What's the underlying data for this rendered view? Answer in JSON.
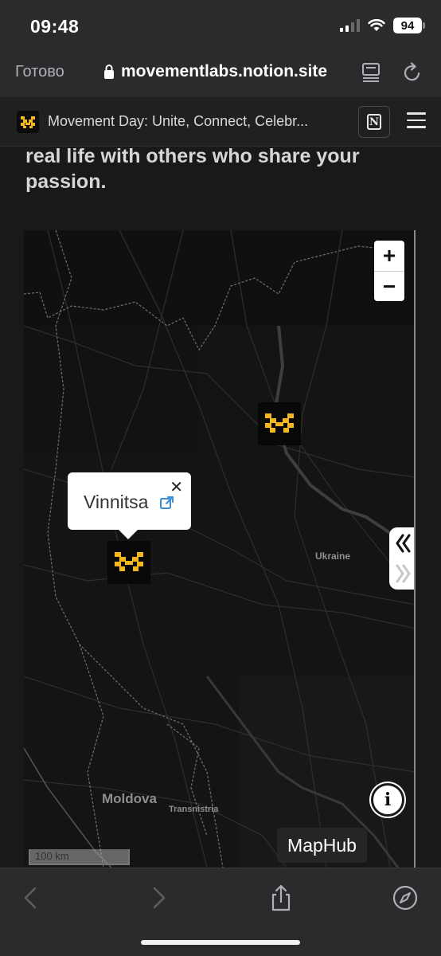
{
  "status_bar": {
    "time": "09:48",
    "battery": "94"
  },
  "browser": {
    "done_label": "Готово",
    "url": "movementlabs.notion.site"
  },
  "notion_header": {
    "page_title": "Movement Day: Unite, Connect, Celebr..."
  },
  "page": {
    "text_line1": "real life with others who share your",
    "text_line2": "passion."
  },
  "map": {
    "zoom_in_label": "+",
    "zoom_out_label": "−",
    "popup": {
      "title": "Vinnitsa",
      "close_label": "✕"
    },
    "labels": {
      "ukraine": "Ukraine",
      "moldova": "Moldova",
      "transnistria": "Transnistria"
    },
    "info_label": "i",
    "brand": "MapHub",
    "scale": "100 km"
  },
  "colors": {
    "logo_yellow": "#f4b71c",
    "map_bg": "#141414",
    "chrome_bg": "#2b2b2d"
  }
}
